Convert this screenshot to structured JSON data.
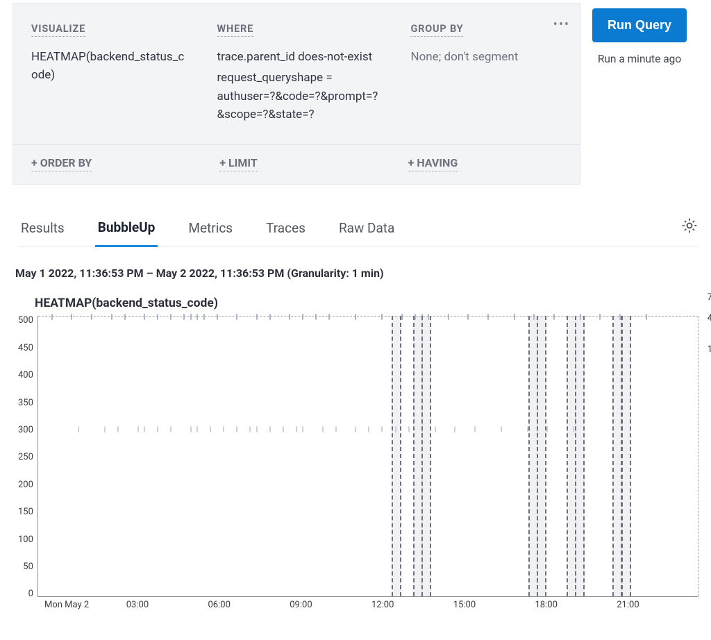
{
  "query": {
    "visualize": {
      "label": "VISUALIZE",
      "value": "HEATMAP(backend_status_code)"
    },
    "where": {
      "label": "WHERE",
      "lines": [
        "trace.parent_id does-not-exist",
        "request_queryshape = authuser=?&code=?&prompt=?&scope=?&state=?"
      ]
    },
    "group_by": {
      "label": "GROUP BY",
      "value": "None; don't segment"
    },
    "footer": {
      "order_by": "+ ORDER BY",
      "limit": "+ LIMIT",
      "having": "+ HAVING"
    },
    "more_icon": "more-icon"
  },
  "run": {
    "button": "Run Query",
    "timestamp": "Run a minute ago"
  },
  "tabs": [
    "Results",
    "BubbleUp",
    "Metrics",
    "Traces",
    "Raw Data"
  ],
  "active_tab": "BubbleUp",
  "time_range": "May 1 2022, 11:36:53 PM – May 2 2022, 11:36:53 PM (Granularity: 1 min)",
  "chart_data": {
    "type": "heatmap",
    "title": "HEATMAP(backend_status_code)",
    "ylabel": "",
    "xlabel": "",
    "ylim": [
      0,
      500
    ],
    "y_ticks": [
      500,
      450,
      400,
      350,
      300,
      250,
      200,
      150,
      100,
      50,
      0
    ],
    "x_ticks": [
      "Mon May 2",
      "03:00",
      "06:00",
      "09:00",
      "12:00",
      "15:00",
      "18:00",
      "21:00"
    ],
    "legend": {
      "max": 7,
      "mid": 4,
      "min": 1,
      "colors": [
        "#1a2240",
        "#2b3560",
        "#2d5fa6",
        "#3d7fd6",
        "#6aa8e8",
        "#a7ccf2"
      ]
    },
    "series_rows": {
      "500": {
        "x_pcts": [
          2,
          5,
          8,
          11,
          13,
          16,
          18,
          20,
          22,
          23,
          24,
          25,
          27,
          30,
          33,
          35,
          38,
          40,
          42,
          44,
          48,
          52,
          55,
          57,
          58,
          59,
          62,
          65,
          68,
          72,
          75,
          78,
          82,
          85,
          88,
          92
        ]
      },
      "300": {
        "x_pcts": [
          6,
          10,
          12,
          15,
          16,
          18,
          20,
          23,
          24,
          26,
          28,
          30,
          32,
          33,
          35,
          37,
          39,
          40,
          43,
          45,
          48,
          50,
          52,
          54,
          56,
          58,
          60,
          63,
          66,
          70,
          74,
          77,
          81
        ]
      }
    },
    "markers_x_pct": [
      53.5,
      56.8,
      58.0,
      74.2,
      75.5,
      80.0,
      81.3,
      87.0,
      88.3
    ]
  }
}
